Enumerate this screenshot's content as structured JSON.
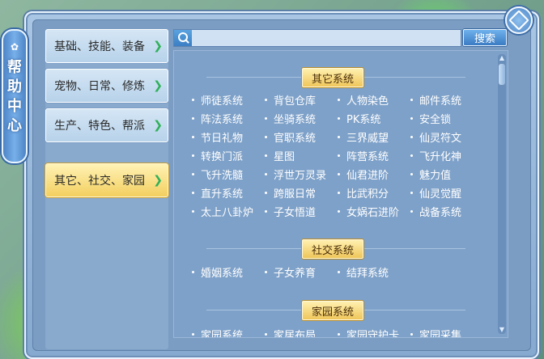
{
  "banner": {
    "chars": [
      "帮",
      "助",
      "中",
      "心"
    ]
  },
  "nav": {
    "items": [
      {
        "label": "基础、技能、装备",
        "active": false
      },
      {
        "label": "宠物、日常、修炼",
        "active": false
      },
      {
        "label": "生产、特色、帮派",
        "active": false
      },
      {
        "label": "其它、社交、家园",
        "active": true
      }
    ]
  },
  "search": {
    "value": "",
    "placeholder": "",
    "button_label": "搜索"
  },
  "sections": [
    {
      "title": "其它系统",
      "items": [
        "师徒系统",
        "背包仓库",
        "人物染色",
        "邮件系统",
        "阵法系统",
        "坐骑系统",
        "PK系统",
        "安全锁",
        "节日礼物",
        "官职系统",
        "三界威望",
        "仙灵符文",
        "转换门派",
        "星图",
        "阵营系统",
        "飞升化神",
        "飞升洗髓",
        "浮世万灵录",
        "仙君进阶",
        "魅力值",
        "直升系统",
        "跨服日常",
        "比武积分",
        "仙灵觉醒",
        "太上八卦炉",
        "子女悟道",
        "女娲石进阶",
        "战备系统"
      ]
    },
    {
      "title": "社交系统",
      "items": [
        "婚姻系统",
        "子女养育",
        "结拜系统"
      ]
    },
    {
      "title": "家园系统",
      "items": [
        "家园系统",
        "家居布局",
        "家园守护卡",
        "家园采集"
      ]
    }
  ],
  "colors": {
    "accent_gold": "#efc65a",
    "panel_blue": "#7ea1c9",
    "nav_active": "#f3cf5f"
  }
}
